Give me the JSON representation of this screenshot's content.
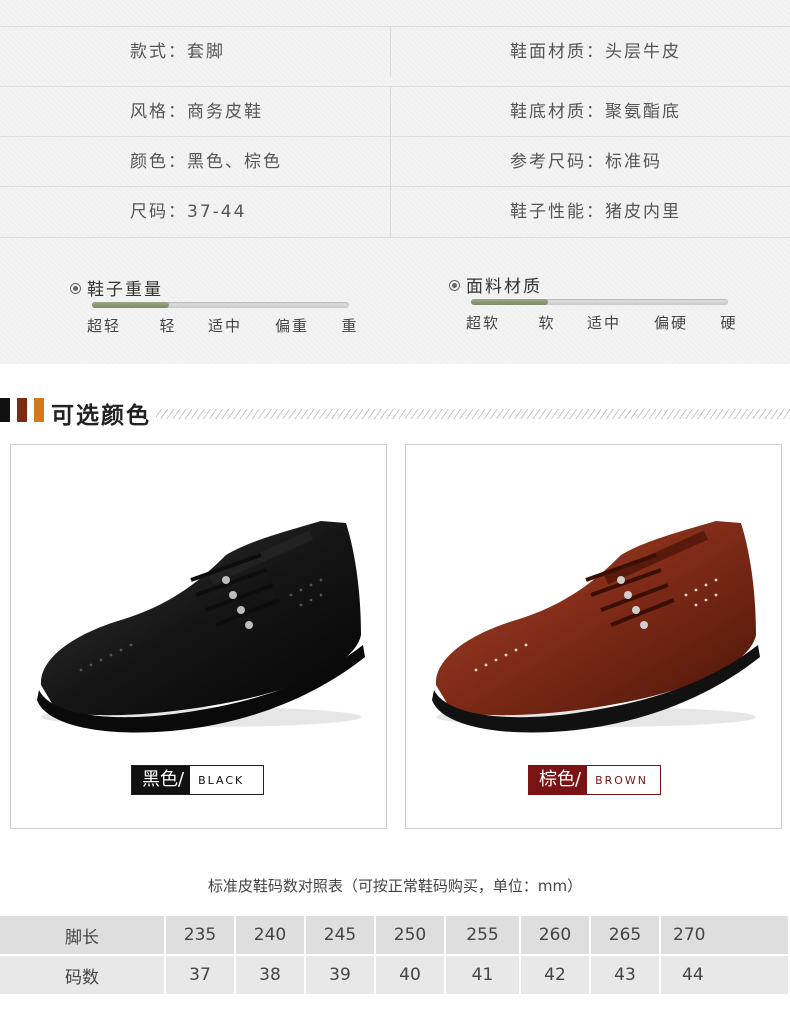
{
  "spec": {
    "rows": [
      {
        "left": "款式：套脚",
        "right": "鞋面材质：头层牛皮"
      },
      {
        "left": "风格：商务皮鞋",
        "right": "鞋底材质：聚氨酯底"
      },
      {
        "left": "颜色：黑色、棕色",
        "right": "参考尺码：标准码"
      },
      {
        "left": "尺码：37-44",
        "right": "鞋子性能：猪皮内里"
      }
    ],
    "weight": {
      "title": "鞋子重量",
      "labels": [
        "超轻",
        "轻",
        "适中",
        "偏重",
        "重"
      ],
      "level": 0.3
    },
    "material": {
      "title": "面料材质",
      "labels": [
        "超软",
        "软",
        "适中",
        "偏硬",
        "硬"
      ],
      "level": 0.3
    }
  },
  "section": {
    "title": "可选颜色",
    "accent_colors": [
      "#111111",
      "#7a2c14",
      "#d57a1c"
    ]
  },
  "colors": [
    {
      "cn": "黑色/",
      "en": "BLACK",
      "badge_bg": "#111111",
      "en_color": "#111111",
      "shoe": "black"
    },
    {
      "cn": "棕色/",
      "en": "BROWN",
      "badge_bg": "#7a1414",
      "en_color": "#7a1414",
      "shoe": "brown"
    }
  ],
  "size_table": {
    "caption": "标准皮鞋码数对照表（可按正常鞋码购买，单位：mm）",
    "rows": [
      {
        "label": "脚长",
        "values": [
          "235",
          "240",
          "245",
          "250",
          "255",
          "260",
          "265",
          "270"
        ]
      },
      {
        "label": "码数",
        "values": [
          "37",
          "38",
          "39",
          "40",
          "41",
          "42",
          "43",
          "44"
        ]
      }
    ]
  }
}
